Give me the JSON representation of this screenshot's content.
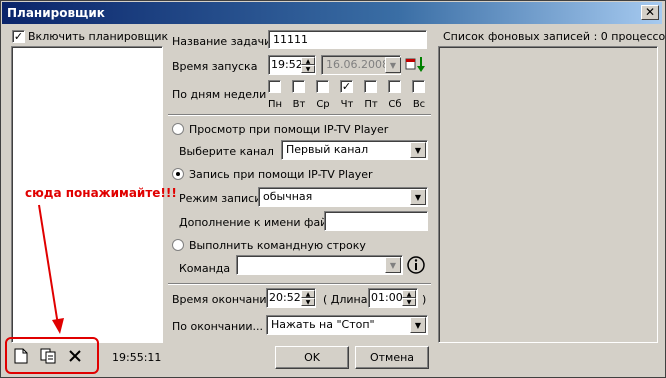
{
  "window": {
    "title": "Планировщик",
    "close_glyph": "✕"
  },
  "left": {
    "enable_label": "Включить планировщик",
    "enable_checked": true,
    "time": "19:55:11",
    "annotation": "сюда понажимайте!!!",
    "toolbar": {
      "new_icon": "new-document-icon",
      "copy_icon": "copy-icon",
      "delete_icon": "delete-icon"
    }
  },
  "form": {
    "task_name_label": "Название задачи",
    "task_name_value": "11111",
    "start_time_label": "Время запуска",
    "start_time_value": "19:52",
    "start_date_value": "16.06.2008",
    "days_label": "По дням недели",
    "days": [
      {
        "label": "Пн",
        "checked": false
      },
      {
        "label": "Вт",
        "checked": false
      },
      {
        "label": "Ср",
        "checked": false
      },
      {
        "label": "Чт",
        "checked": true
      },
      {
        "label": "Пт",
        "checked": false
      },
      {
        "label": "Сб",
        "checked": false
      },
      {
        "label": "Вс",
        "checked": false
      }
    ],
    "view_radio_label": "Просмотр при помощи IP-TV Player",
    "channel_label": "Выберите канал",
    "channel_value": "Первый канал",
    "record_radio_label": "Запись при помощи IP-TV Player",
    "record_mode_label": "Режим записи",
    "record_mode_value": "обычная",
    "filename_suffix_label": "Дополнение к имени файла",
    "filename_suffix_value": "",
    "cmd_radio_label": "Выполнить командную строку",
    "command_label": "Команда",
    "command_value": "",
    "end_time_label": "Время окончания",
    "end_time_value": "20:52",
    "duration_open": "( Длина",
    "duration_value": "01:00",
    "duration_close": ")",
    "on_end_label": "По окончании...",
    "on_end_value": "Нажать на \"Стоп\"",
    "ok_label": "OK",
    "cancel_label": "Отмена"
  },
  "right": {
    "list_label": "Список фоновых записей :",
    "count": "0",
    "processes_label": "процессов"
  },
  "colors": {
    "annotation": "#e00000",
    "titlebar": "#0a246a"
  }
}
